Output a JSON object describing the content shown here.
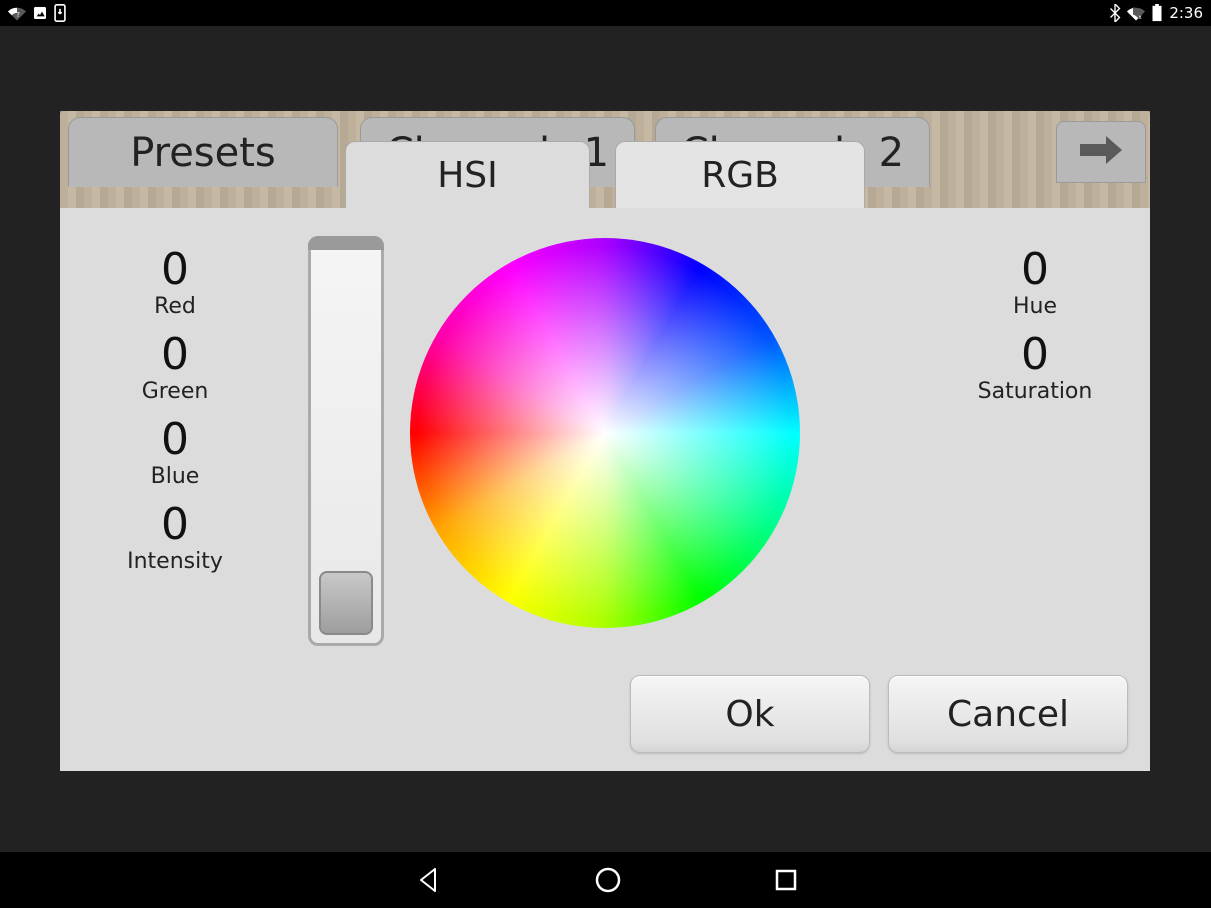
{
  "statusbar": {
    "time": "2:36"
  },
  "tabs": {
    "presets": "Presets",
    "channels": [
      "Channels 1",
      "Channels 2"
    ],
    "sub": {
      "hsi": "HSI",
      "rgb": "RGB"
    }
  },
  "readouts_left": [
    {
      "value": "0",
      "label": "Red"
    },
    {
      "value": "0",
      "label": "Green"
    },
    {
      "value": "0",
      "label": "Blue"
    },
    {
      "value": "0",
      "label": "Intensity"
    }
  ],
  "readouts_right": [
    {
      "value": "0",
      "label": "Hue"
    },
    {
      "value": "0",
      "label": "Saturation"
    }
  ],
  "buttons": {
    "ok": "Ok",
    "cancel": "Cancel"
  }
}
